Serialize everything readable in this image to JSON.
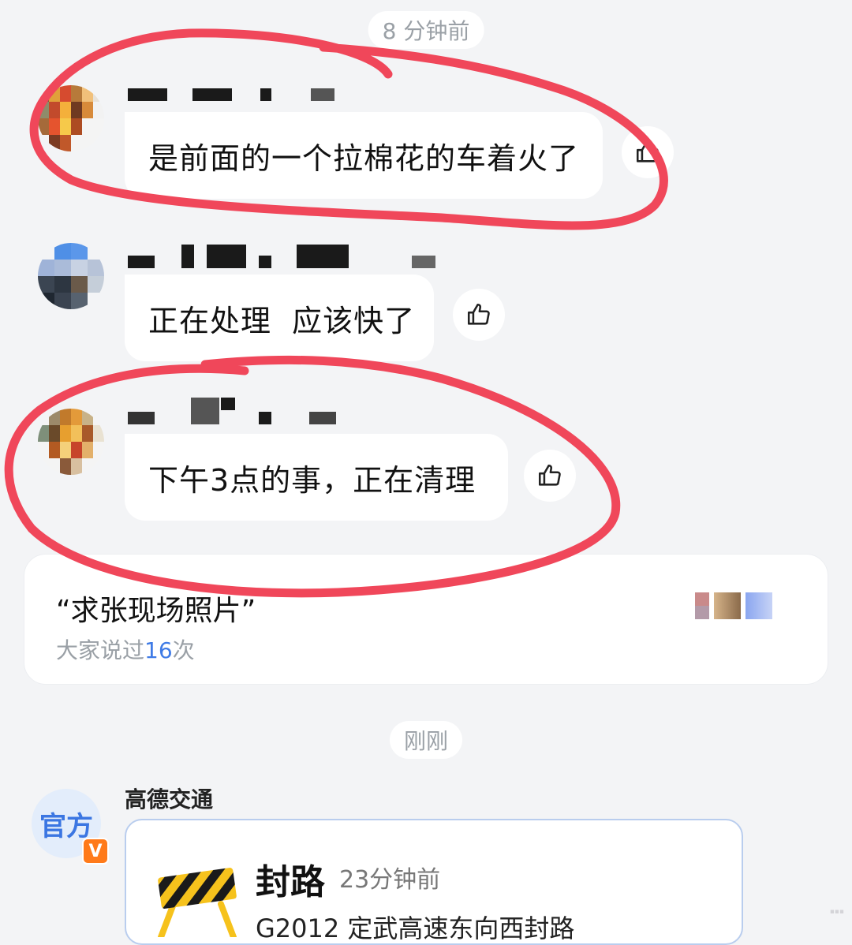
{
  "timestamps": {
    "earlier": "8 分钟前",
    "recent": "刚刚"
  },
  "messages": [
    {
      "text": "是前面的一个拉棉花的车着火了"
    },
    {
      "text": "正在处理  应该快了"
    },
    {
      "text": "下午3点的事，正在清理"
    }
  ],
  "quote_card": {
    "text": "“求张现场照片”",
    "sub_prefix": "大家说过",
    "sub_count": "16",
    "sub_suffix": "次"
  },
  "official": {
    "avatar_label": "官方",
    "badge": "V",
    "name": "高德交通",
    "notice": {
      "title": "封路",
      "time": "23分钟前",
      "body": "G2012 定武高速东向西封路"
    }
  },
  "icons": {
    "like": "thumbs-up-icon",
    "roadblock": "roadblock-icon"
  },
  "colors": {
    "annotation": "#f0475a",
    "accent": "#3f7be6",
    "badge": "#ff7a1a"
  }
}
